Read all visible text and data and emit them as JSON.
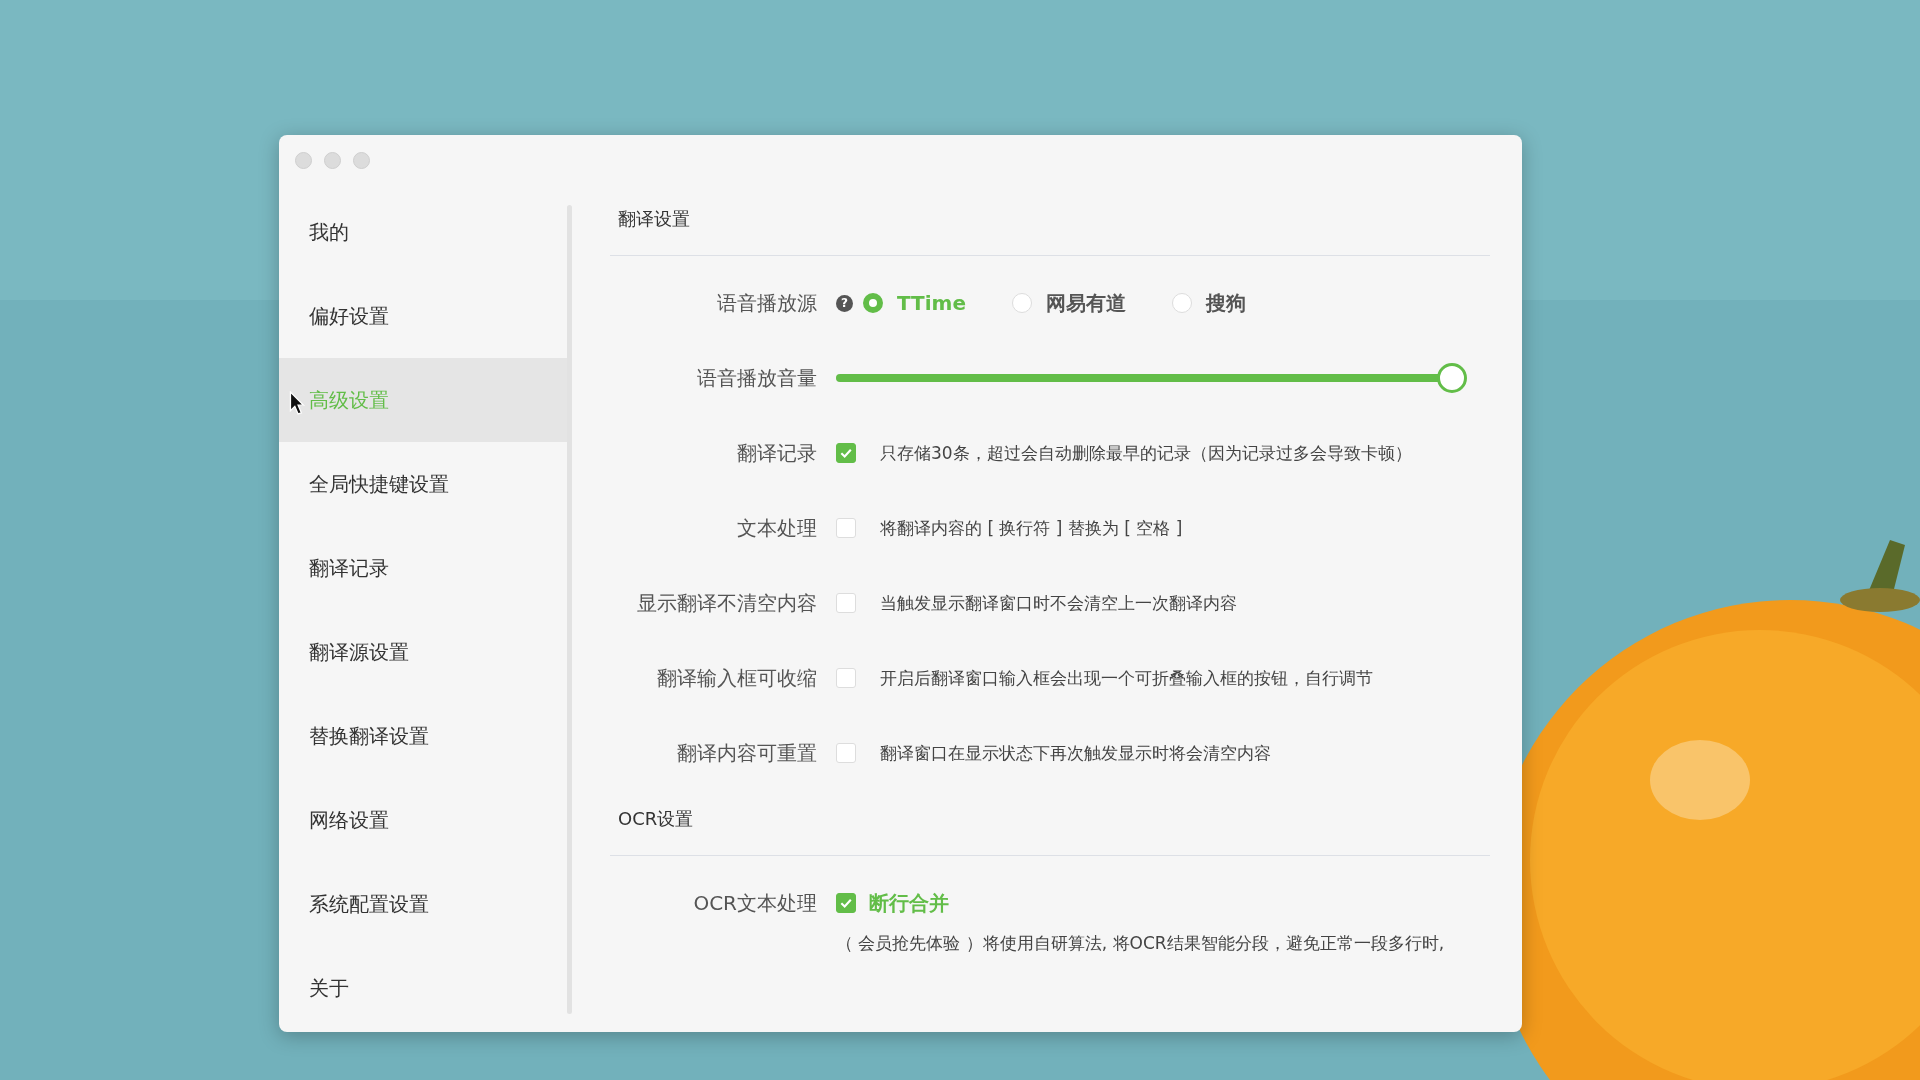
{
  "sidebar": {
    "items": [
      {
        "label": "我的",
        "selected": false
      },
      {
        "label": "偏好设置",
        "selected": false
      },
      {
        "label": "高级设置",
        "selected": true
      },
      {
        "label": "全局快捷键设置",
        "selected": false
      },
      {
        "label": "翻译记录",
        "selected": false
      },
      {
        "label": "翻译源设置",
        "selected": false
      },
      {
        "label": "替换翻译设置",
        "selected": false
      },
      {
        "label": "网络设置",
        "selected": false
      },
      {
        "label": "系统配置设置",
        "selected": false
      },
      {
        "label": "关于",
        "selected": false
      }
    ]
  },
  "sections": [
    {
      "title": "翻译设置",
      "rows": [
        {
          "kind": "radio",
          "label": "语音播放源",
          "help": "?",
          "options": [
            {
              "label": "TTime",
              "selected": true
            },
            {
              "label": "网易有道",
              "selected": false
            },
            {
              "label": "搜狗",
              "selected": false
            }
          ]
        },
        {
          "kind": "slider",
          "label": "语音播放音量",
          "level": 1
        },
        {
          "kind": "checkbox",
          "label": "翻译记录",
          "checked": true,
          "text": "只存储30条，超过会自动删除最早的记录（因为记录过多会导致卡顿）"
        },
        {
          "kind": "checkbox",
          "label": "文本处理",
          "checked": false,
          "text": "将翻译内容的 [ 换行符 ] 替换为 [ 空格 ]"
        },
        {
          "kind": "checkbox",
          "label": "显示翻译不清空内容",
          "checked": false,
          "text": "当触发显示翻译窗口时不会清空上一次翻译内容"
        },
        {
          "kind": "checkbox",
          "label": "翻译输入框可收缩",
          "checked": false,
          "text": "开启后翻译窗口输入框会出现一个可折叠输入框的按钮，自行调节"
        },
        {
          "kind": "checkbox",
          "label": "翻译内容可重置",
          "checked": false,
          "text": "翻译窗口在显示状态下再次触发显示时将会清空内容"
        }
      ]
    },
    {
      "title": "OCR设置",
      "rows": [
        {
          "kind": "option",
          "label": "OCR文本处理",
          "checked": true,
          "option": "断行合并",
          "note": "（ 会员抢先体验 ）将使用自研算法, 将OCR结果智能分段，避免正常一段多行时,"
        }
      ]
    }
  ]
}
